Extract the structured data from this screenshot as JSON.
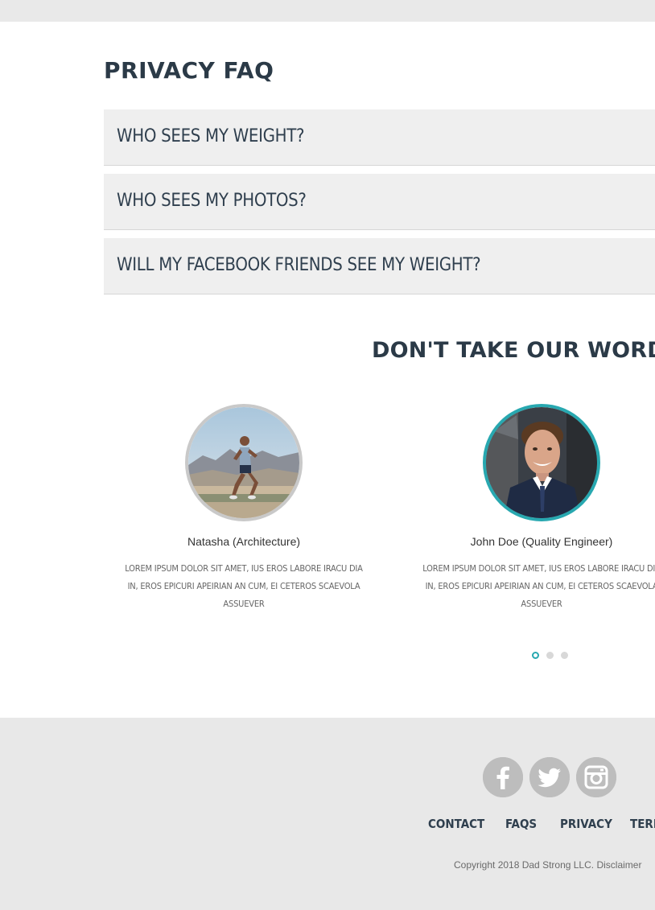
{
  "faq": {
    "title": "PRIVACY FAQ",
    "items": [
      {
        "question": "WHO SEES MY WEIGHT?"
      },
      {
        "question": "WHO SEES MY PHOTOS?"
      },
      {
        "question": "WILL MY FACEBOOK FRIENDS SEE MY WEIGHT?"
      }
    ]
  },
  "testimonials": {
    "heading": "DON'T TAKE OUR WORD",
    "items": [
      {
        "name": "Natasha (Architecture)",
        "quote": "LOREM IPSUM DOLOR SIT AMET, IUS EROS LABORE IRACU DIA IN, EROS EPICURI APEIRIAN AN CUM, EI CETEROS SCAEVOLA ASSUEVER"
      },
      {
        "name": "John Doe (Quality Engineer)",
        "quote": "LOREM IPSUM DOLOR SIT AMET, IUS EROS LABORE IRACU DIA IN, EROS EPICURI APEIRIAN AN CUM, EI CETEROS SCAEVOLA ASSUEVER"
      }
    ],
    "pagination": {
      "active_index": 1,
      "total": 3
    },
    "accent_color": "#28a8b0"
  },
  "footer": {
    "social": [
      "facebook-icon",
      "twitter-icon",
      "instagram-icon"
    ],
    "nav": [
      "CONTACT",
      "FAQS",
      "PRIVACY",
      "TERI"
    ],
    "copyright": "Copyright 2018 Dad Strong LLC.",
    "disclaimer": "Disclaimer"
  }
}
